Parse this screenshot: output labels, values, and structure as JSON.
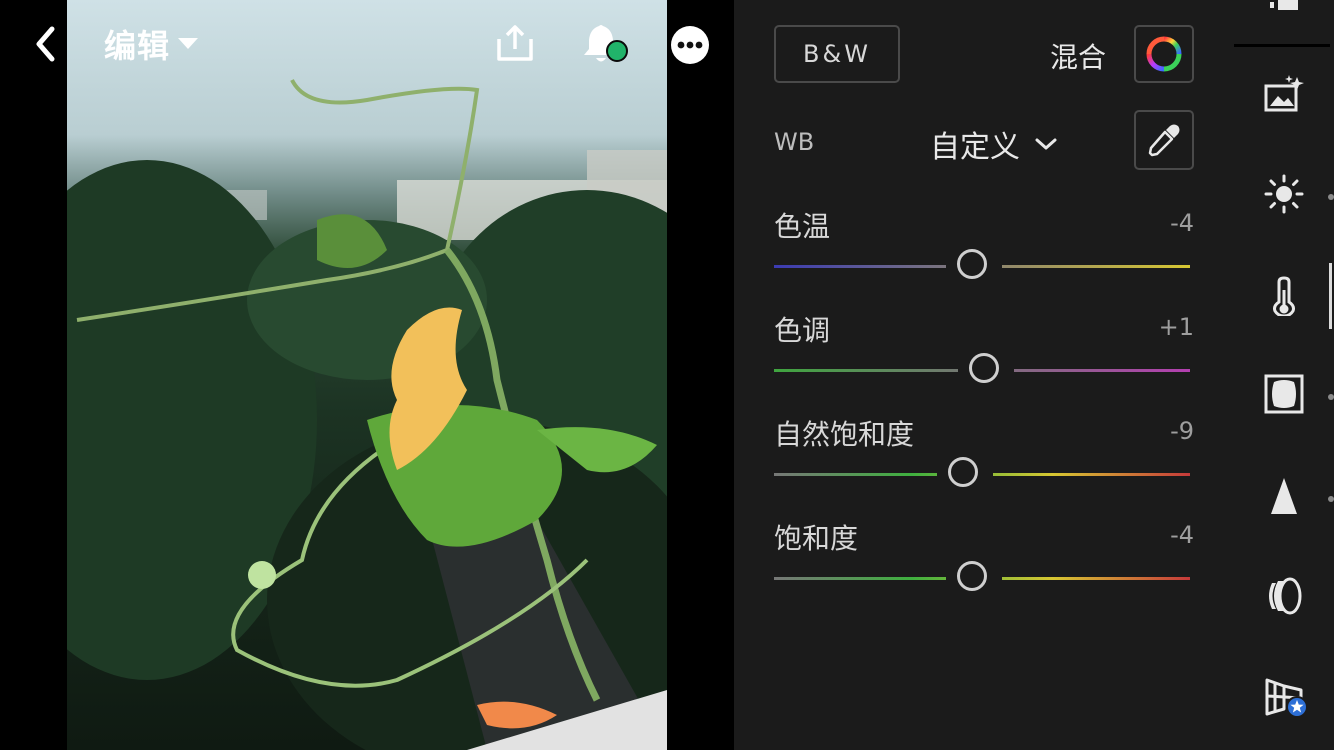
{
  "header": {
    "title": "编辑",
    "icons": [
      "back-chevron-icon",
      "dropdown-caret-icon",
      "share-icon",
      "bell-icon",
      "more-icon"
    ],
    "notification_dot_color": "#21b36a"
  },
  "panel": {
    "bw_label": "B&W",
    "mix_label": "混合",
    "wb_label": "WB",
    "wb_value": "自定义",
    "sliders": [
      {
        "label": "色温",
        "value_text": "-4",
        "position": 0.48,
        "gradient": [
          "#3b3bb3",
          "#d7c732"
        ]
      },
      {
        "label": "色调",
        "value_text": "+1",
        "position": 0.51,
        "gradient": [
          "#3fa53f",
          "#b43fb0"
        ]
      },
      {
        "label": "自然饱和度",
        "value_text": "-9",
        "position": 0.46,
        "gradient": [
          "#777777",
          "#3fb03f",
          "#d7c732",
          "#c63a3a"
        ]
      },
      {
        "label": "饱和度",
        "value_text": "-4",
        "position": 0.48,
        "gradient": [
          "#777777",
          "#3fb03f",
          "#d7c732",
          "#c63a3a"
        ]
      }
    ]
  },
  "sidebar": {
    "items": [
      "presets-icon",
      "light-icon",
      "color-icon",
      "effects-icon",
      "detail-icon",
      "optics-icon",
      "geometry-icon"
    ],
    "active": "color-icon",
    "badge_color": "#2d6fd6"
  }
}
